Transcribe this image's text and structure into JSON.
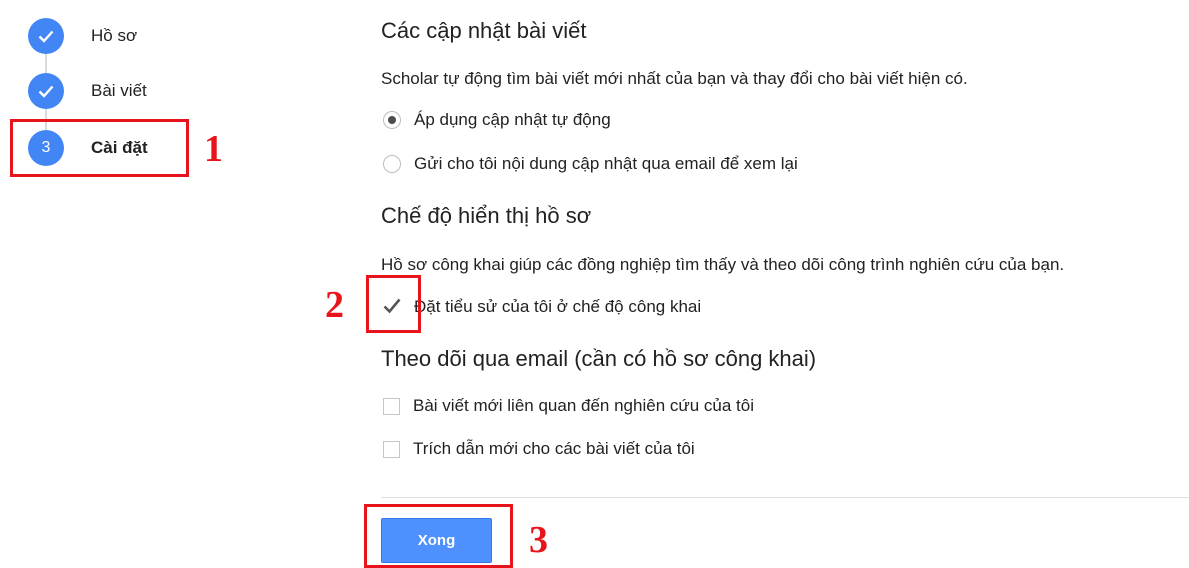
{
  "stepper": {
    "steps": [
      {
        "label": "Hồ sơ",
        "state": "done",
        "number": ""
      },
      {
        "label": "Bài viết",
        "state": "done",
        "number": ""
      },
      {
        "label": "Cài đặt",
        "state": "active",
        "number": "3"
      }
    ]
  },
  "article_updates": {
    "title": "Các cập nhật bài viết",
    "description": "Scholar tự động tìm bài viết mới nhất của bạn và thay đổi cho bài viết hiện có.",
    "options": [
      {
        "label": "Áp dụng cập nhật tự động",
        "selected": true
      },
      {
        "label": "Gửi cho tôi nội dung cập nhật qua email để xem lại",
        "selected": false
      }
    ]
  },
  "profile_visibility": {
    "title": "Chế độ hiển thị hồ sơ",
    "description": "Hồ sơ công khai giúp các đồng nghiệp tìm thấy và theo dõi công trình nghiên cứu của bạn.",
    "public_checkbox": {
      "label": "Đặt tiểu sử của tôi ở chế độ công khai",
      "checked": true
    }
  },
  "email_follow": {
    "title": "Theo dõi qua email (cần có hồ sơ công khai)",
    "options": [
      {
        "label": "Bài viết mới liên quan đến nghiên cứu của tôi",
        "checked": false
      },
      {
        "label": "Trích dẫn mới cho các bài viết của tôi",
        "checked": false
      }
    ]
  },
  "done_button": {
    "label": "Xong"
  },
  "annotations": {
    "n1": "1",
    "n2": "2",
    "n3": "3",
    "color": "#e8141b"
  },
  "colors": {
    "accent": "#4285f4",
    "button": "#4d90fe"
  },
  "icons": {
    "done_step": "checkmark-icon",
    "checkbox_checked": "checkmark-icon"
  }
}
